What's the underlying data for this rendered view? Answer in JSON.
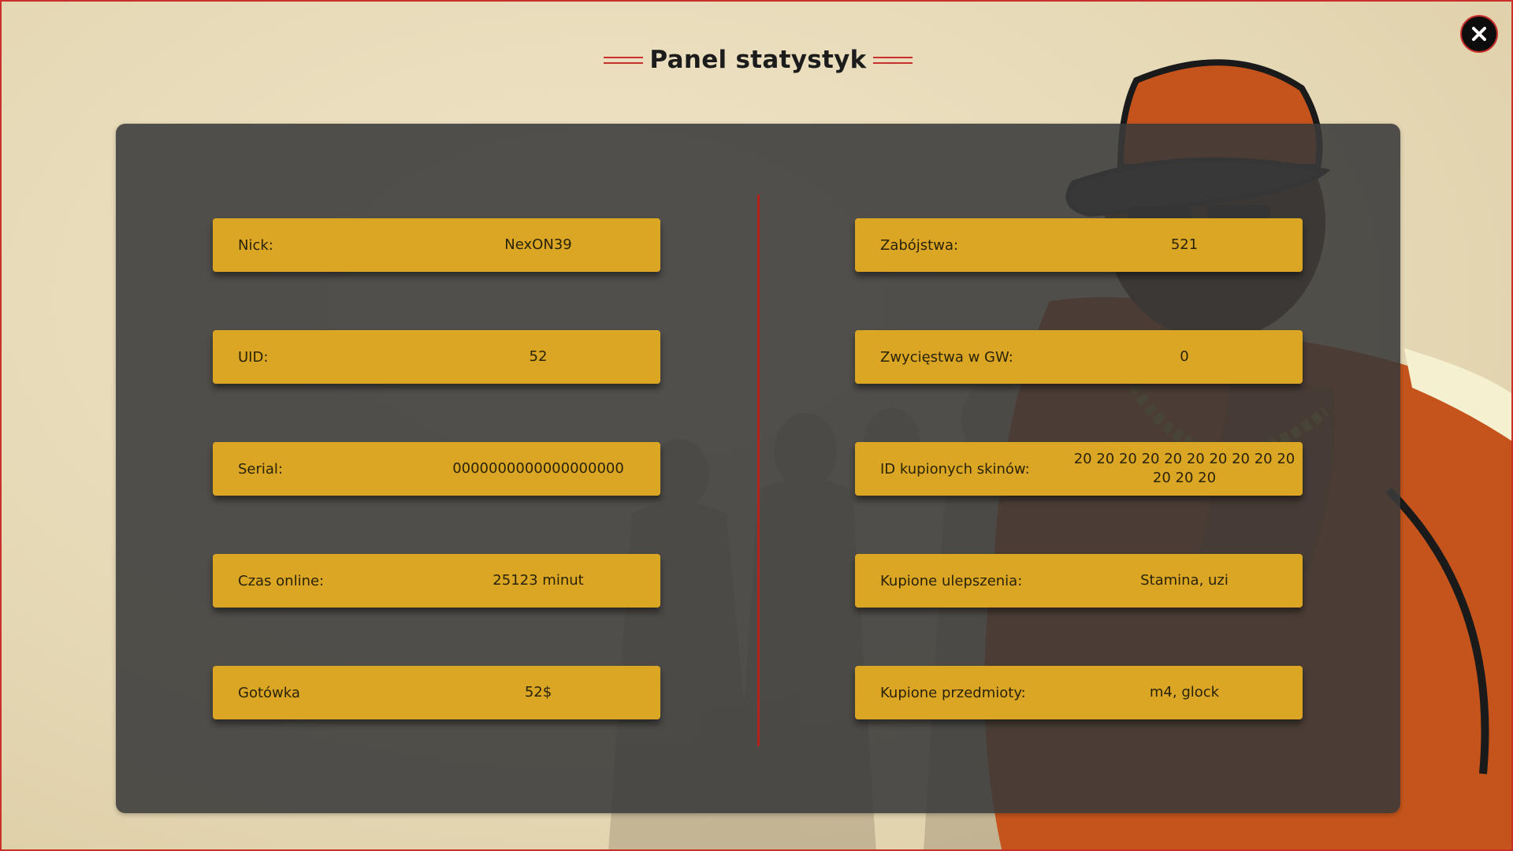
{
  "window": {
    "title": "Panel statystyk"
  },
  "colors": {
    "accent": "#c9302c",
    "card": "#dba624",
    "panel": "#3a3a3a",
    "background": "#e6d9b6"
  },
  "close_button": {
    "icon": "close-icon"
  },
  "left_stats": [
    {
      "label": "Nick:",
      "value": "NexON39"
    },
    {
      "label": "UID:",
      "value": "52"
    },
    {
      "label": "Serial:",
      "value": "0000000000000000000"
    },
    {
      "label": "Czas online:",
      "value": "25123 minut"
    },
    {
      "label": "Gotówka",
      "value": "52$"
    }
  ],
  "right_stats": [
    {
      "label": "Zabójstwa:",
      "value": "521"
    },
    {
      "label": "Zwycięstwa w GW:",
      "value": "0"
    },
    {
      "label": "ID kupionych skinów:",
      "value": "20 20 20 20 20 20 20 20 20 20 20 20 20"
    },
    {
      "label": "Kupione ulepszenia:",
      "value": "Stamina, uzi"
    },
    {
      "label": "Kupione przedmioty:",
      "value": "m4, glock"
    }
  ]
}
